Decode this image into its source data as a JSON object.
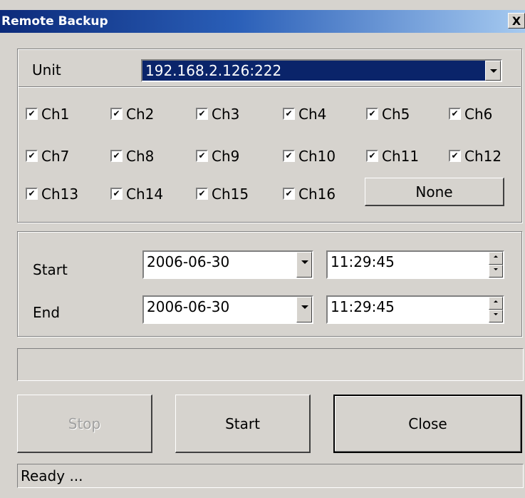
{
  "window": {
    "title": "Remote Backup",
    "close_glyph": "X"
  },
  "unit": {
    "label": "Unit",
    "value": "192.168.2.126:222"
  },
  "channels": [
    {
      "label": "Ch1",
      "checked": true
    },
    {
      "label": "Ch2",
      "checked": true
    },
    {
      "label": "Ch3",
      "checked": true
    },
    {
      "label": "Ch4",
      "checked": true
    },
    {
      "label": "Ch5",
      "checked": true
    },
    {
      "label": "Ch6",
      "checked": true
    },
    {
      "label": "Ch7",
      "checked": true
    },
    {
      "label": "Ch8",
      "checked": true
    },
    {
      "label": "Ch9",
      "checked": true
    },
    {
      "label": "Ch10",
      "checked": true
    },
    {
      "label": "Ch11",
      "checked": true
    },
    {
      "label": "Ch12",
      "checked": true
    },
    {
      "label": "Ch13",
      "checked": true
    },
    {
      "label": "Ch14",
      "checked": true
    },
    {
      "label": "Ch15",
      "checked": true
    },
    {
      "label": "Ch16",
      "checked": true
    }
  ],
  "none_button": "None",
  "range": {
    "start": {
      "label": "Start",
      "date": "2006-06-30",
      "time": "11:29:45"
    },
    "end": {
      "label": "End",
      "date": "2006-06-30",
      "time": "11:29:45"
    }
  },
  "progress": {
    "value": 0
  },
  "buttons": {
    "stop": "Stop",
    "start": "Start",
    "close": "Close"
  },
  "status": "Ready ...",
  "colors": {
    "face": "#d6d3ce",
    "selection": "#0a246a",
    "title_start": "#0c2a7a"
  }
}
